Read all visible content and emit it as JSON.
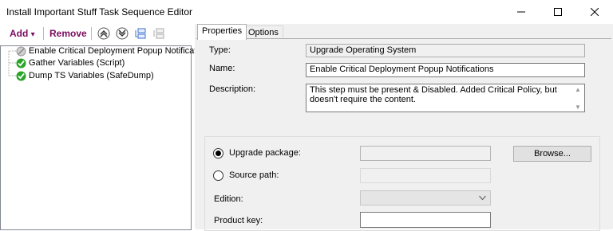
{
  "window": {
    "title": "Install Important Stuff Task Sequence Editor",
    "minimize_glyph": "—",
    "maximize_glyph": "☐",
    "close_glyph": "✕"
  },
  "toolbar": {
    "add_label": "Add",
    "add_arrow": "▾",
    "remove_label": "Remove"
  },
  "tree": {
    "items": [
      {
        "label": "Enable Critical Deployment Popup Notifications",
        "icon": "disabled-step-icon"
      },
      {
        "label": "Gather Variables (Script)",
        "icon": "green-check-icon"
      },
      {
        "label": "Dump TS Variables (SafeDump)",
        "icon": "green-check-icon"
      }
    ]
  },
  "tabs": [
    "Properties",
    "Options"
  ],
  "properties": {
    "type_label": "Type:",
    "type_value": "Upgrade Operating System",
    "name_label": "Name:",
    "name_value": "Enable Critical Deployment Popup Notifications",
    "description_label": "Description:",
    "description_value": "This step must be present & Disabled.  Added Critical Policy, but doesn't require the content."
  },
  "upgrade": {
    "package_label": "Upgrade package:",
    "source_label": "Source path:",
    "edition_label": "Edition:",
    "product_key_label": "Product key:",
    "browse_label": "Browse...",
    "selected_option": "Upgrade package:"
  },
  "colors": {
    "toolbar_text": "#7a0c5e",
    "check_green": "#2aa52a"
  }
}
